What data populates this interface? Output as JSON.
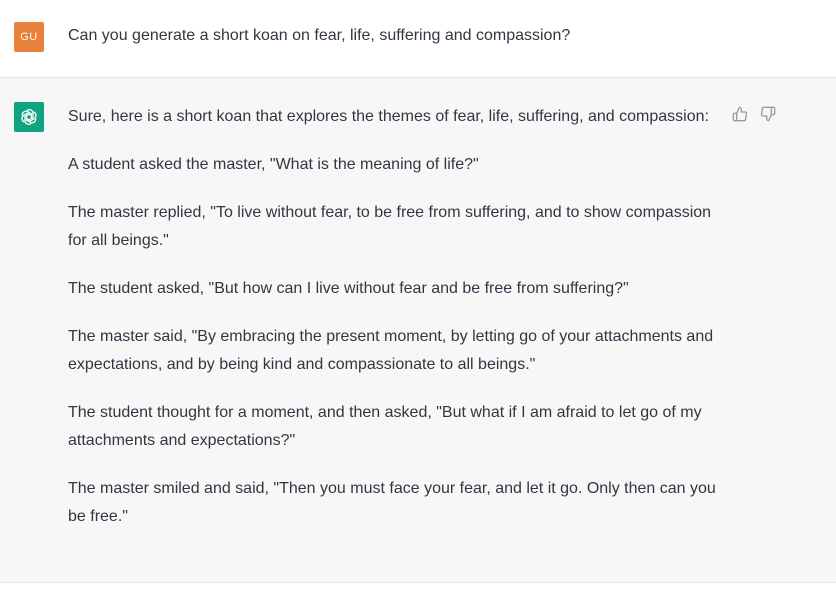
{
  "user": {
    "avatar_initials": "GU",
    "avatar_color": "#e8823a",
    "message": "Can you generate a short koan on fear, life, suffering and compassion?"
  },
  "assistant": {
    "avatar_icon": "openai-logo-icon",
    "avatar_color": "#10a37f",
    "paragraphs": [
      "Sure, here is a short koan that explores the themes of fear, life, suffering, and compassion:",
      "A student asked the master, \"What is the meaning of life?\"",
      "The master replied, \"To live without fear, to be free from suffering, and to show compassion for all beings.\"",
      "The student asked, \"But how can I live without fear and be free from suffering?\"",
      "The master said, \"By embracing the present moment, by letting go of your attachments and expectations, and by being kind and compassionate to all beings.\"",
      "The student thought for a moment, and then asked, \"But what if I am afraid to let go of my attachments and expectations?\"",
      "The master smiled and said, \"Then you must face your fear, and let it go. Only then can you be free.\""
    ],
    "feedback": {
      "thumbs_up_icon": "thumbs-up-icon",
      "thumbs_down_icon": "thumbs-down-icon"
    }
  }
}
